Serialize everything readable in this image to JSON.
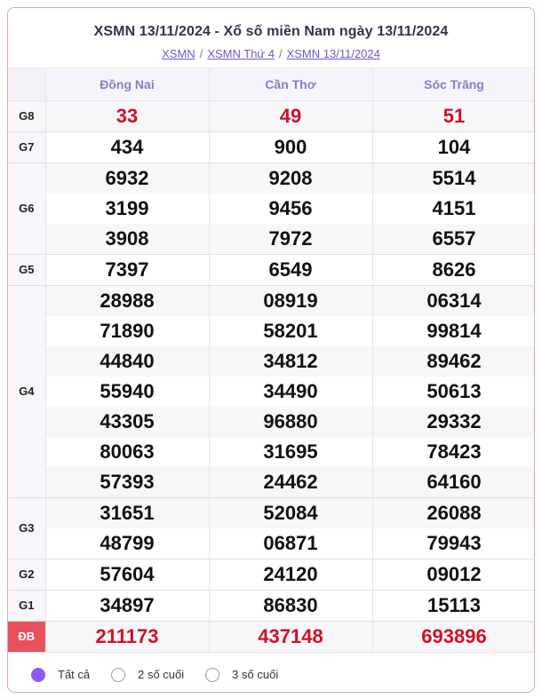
{
  "header": {
    "title": "XSMN 13/11/2024 - Xổ số miền Nam ngày 13/11/2024",
    "breadcrumbs": [
      "XSMN",
      "XSMN Thứ 4",
      "XSMN 13/11/2024"
    ]
  },
  "provinces": [
    "Đồng Nai",
    "Cần Thơ",
    "Sóc Trăng"
  ],
  "prizes": [
    {
      "label": "G8",
      "rows": [
        [
          "33",
          "49",
          "51"
        ]
      ]
    },
    {
      "label": "G7",
      "rows": [
        [
          "434",
          "900",
          "104"
        ]
      ]
    },
    {
      "label": "G6",
      "rows": [
        [
          "6932",
          "9208",
          "5514"
        ],
        [
          "3199",
          "9456",
          "4151"
        ],
        [
          "3908",
          "7972",
          "6557"
        ]
      ]
    },
    {
      "label": "G5",
      "rows": [
        [
          "7397",
          "6549",
          "8626"
        ]
      ]
    },
    {
      "label": "G4",
      "rows": [
        [
          "28988",
          "08919",
          "06314"
        ],
        [
          "71890",
          "58201",
          "99814"
        ],
        [
          "44840",
          "34812",
          "89462"
        ],
        [
          "55940",
          "34490",
          "50613"
        ],
        [
          "43305",
          "96880",
          "29332"
        ],
        [
          "80063",
          "31695",
          "78423"
        ],
        [
          "57393",
          "24462",
          "64160"
        ]
      ]
    },
    {
      "label": "G3",
      "rows": [
        [
          "31651",
          "52084",
          "26088"
        ],
        [
          "48799",
          "06871",
          "79943"
        ]
      ]
    },
    {
      "label": "G2",
      "rows": [
        [
          "57604",
          "24120",
          "09012"
        ]
      ]
    },
    {
      "label": "G1",
      "rows": [
        [
          "34897",
          "86830",
          "15113"
        ]
      ]
    },
    {
      "label": "ĐB",
      "rows": [
        [
          "211173",
          "437148",
          "693896"
        ]
      ]
    }
  ],
  "filters": {
    "options": [
      "Tất cả",
      "2 số cuối",
      "3 số cuối"
    ],
    "selected": "Tất cả"
  },
  "colors": {
    "accent": "#8b5cf6",
    "prize_red": "#d0102a",
    "db_label_bg": "#e8505b"
  }
}
